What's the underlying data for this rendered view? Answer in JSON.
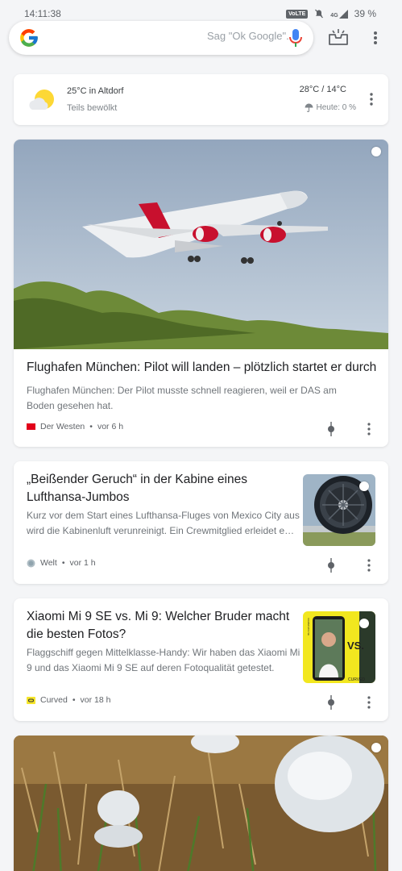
{
  "status_bar": {
    "time": "14:11:38",
    "network": "VoLTE",
    "signal": "4G",
    "battery": "39 %"
  },
  "search": {
    "placeholder": "Sag \"Ok Google\"..."
  },
  "weather": {
    "temp_location": "25°C in Altdorf",
    "condition": "Teils bewölkt",
    "range": "28°C / 14°C",
    "rain": "Heute: 0 %"
  },
  "feed": [
    {
      "headline": "Flughafen München: Pilot will landen – plötzlich startet er durch",
      "snippet": "Flughafen München: Der Pilot musste schnell reagieren, weil er DAS am Boden gesehen hat.",
      "source": "Der Westen",
      "time": "vor 6 h",
      "source_color": "#e2001a"
    },
    {
      "headline": "„Beißender Geruch“ in der Kabine eines Lufthansa-Jumbos",
      "snippet": "Kurz vor dem Start eines Lufthansa-Fluges von Mexico City aus wird die Kabinenluft verunreinigt. Ein Crewmitglied erleidet e…",
      "source": "Welt",
      "time": "vor 1 h"
    },
    {
      "headline": "Xiaomi Mi 9 SE vs. Mi 9: Welcher Bruder macht die besten Fotos?",
      "snippet": "Flaggschiff gegen Mittelklasse-Handy: Wir haben das Xiaomi Mi 9 und das Xiaomi Mi 9 SE auf deren Fotoqualität getestet.",
      "source": "Curved",
      "time": "vor 18 h",
      "source_color": "#f5e52a"
    }
  ],
  "thumb_texts": {
    "vs": "VS.",
    "brand": "CURVED",
    "side": "XIAOMI MI 9 SE"
  },
  "separator": "•"
}
